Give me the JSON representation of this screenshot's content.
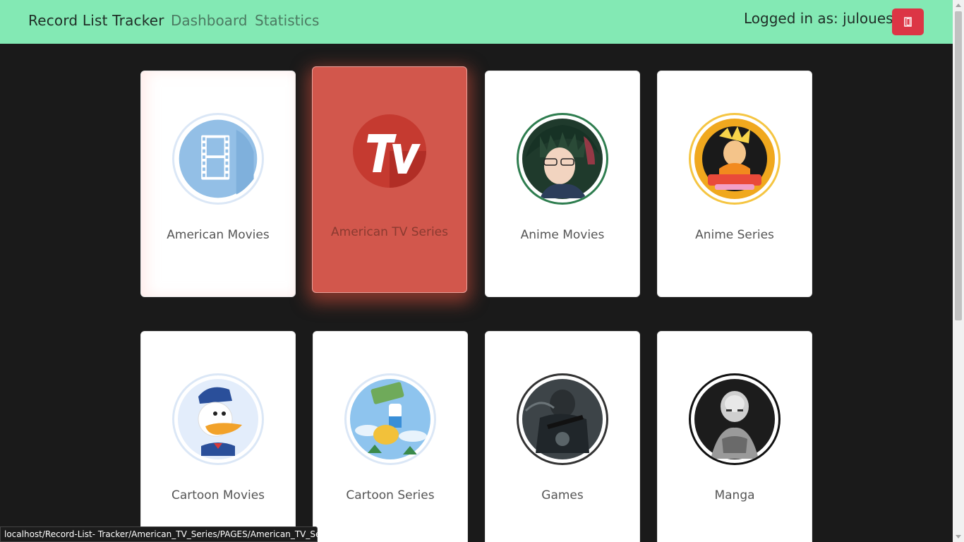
{
  "navbar": {
    "brand": "Record List Tracker",
    "links": [
      "Dashboard",
      "Statistics"
    ],
    "login_text": "Logged in as: juloues",
    "logout_icon": "logout-door-icon"
  },
  "cards": [
    {
      "title": "American Movies",
      "icon": "film-reel-icon"
    },
    {
      "title": "American TV Series",
      "icon": "tv-logo-icon"
    },
    {
      "title": "Anime Movies",
      "icon": "anime-character-avatar"
    },
    {
      "title": "Anime Series",
      "icon": "naruto-shippuden-logo"
    },
    {
      "title": "Cartoon Movies",
      "icon": "donald-duck-avatar"
    },
    {
      "title": "Cartoon Series",
      "icon": "adventure-time-avatar"
    },
    {
      "title": "Games",
      "icon": "game-soldier-avatar"
    },
    {
      "title": "Manga",
      "icon": "one-punch-man-avatar"
    }
  ],
  "status_bar": {
    "url": "localhost/Record-List- Tracker/American_TV_Series/PAGES/American_TV_Series.php"
  },
  "colors": {
    "navbar": "#83e9b4",
    "background": "#1a1a1a",
    "logout": "#dc3545",
    "card_hover": "#d2574c"
  }
}
